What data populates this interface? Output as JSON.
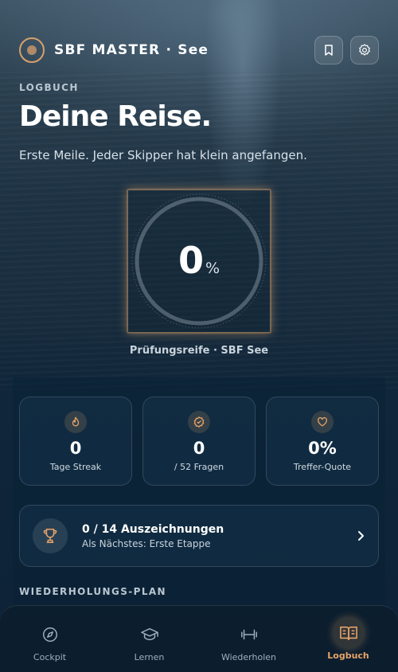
{
  "header": {
    "brand": "SBF MASTER · See",
    "icons": {
      "logo": "compass-logo-icon",
      "bookmark": "bookmark-icon",
      "settings": "gear-icon"
    }
  },
  "hero": {
    "eyebrow": "LOGBUCH",
    "title": "Deine Reise.",
    "subtitle": "Erste Meile. Jeder Skipper hat klein angefangen."
  },
  "progress": {
    "value": "0",
    "unit": "%",
    "fraction": 0,
    "caption": "Prüfungsreife · SBF See"
  },
  "stats": [
    {
      "icon": "flame-icon",
      "value": "0",
      "label": "Tage Streak"
    },
    {
      "icon": "check-badge-icon",
      "value": "0",
      "label": "/ 52 Fragen"
    },
    {
      "icon": "heart-icon",
      "value": "0%",
      "label": "Treffer-Quote"
    }
  ],
  "achievements": {
    "icon": "trophy-icon",
    "title": "0 / 14 Auszeichnungen",
    "subtitle": "Als Nächstes: Erste Etappe"
  },
  "section": {
    "plan_label": "WIEDERHOLUNGS-PLAN"
  },
  "nav": [
    {
      "icon": "compass-icon",
      "label": "Cockpit",
      "active": false
    },
    {
      "icon": "graduation-cap-icon",
      "label": "Lernen",
      "active": false
    },
    {
      "icon": "dumbbell-icon",
      "label": "Wiederholen",
      "active": false
    },
    {
      "icon": "open-book-icon",
      "label": "Logbuch",
      "active": true
    }
  ],
  "colors": {
    "accent": "#e7a56a",
    "background": "#0e2233"
  }
}
